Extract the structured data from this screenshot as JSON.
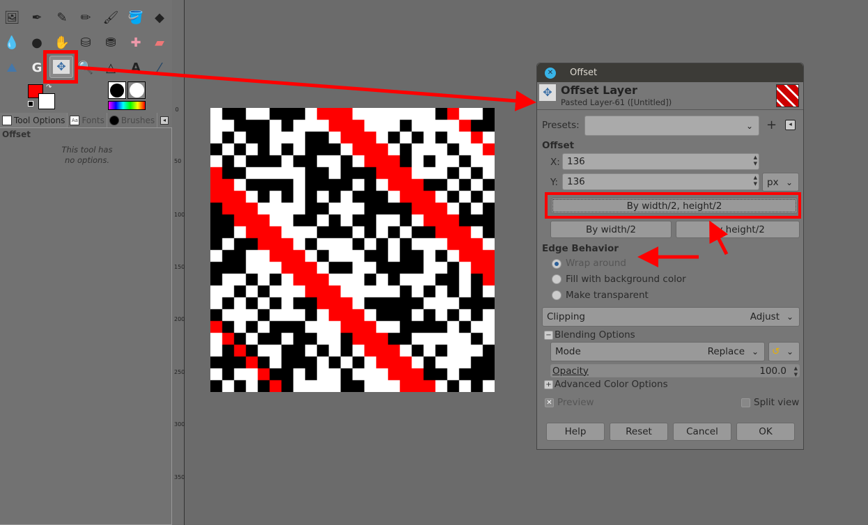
{
  "toolbox": {
    "tool_options_tab": "Tool Options",
    "fonts_tab": "Fonts",
    "brushes_tab": "Brushes",
    "options_title": "Offset",
    "options_message_line1": "This tool has",
    "options_message_line2": "no options.",
    "foreground_color": "#ff0000",
    "background_color": "#ffffff"
  },
  "ruler": {
    "labels": [
      "0",
      "50",
      "100",
      "150",
      "200",
      "250",
      "300",
      "350"
    ]
  },
  "dialog": {
    "window_title": "Offset",
    "header_title": "Offset Layer",
    "header_subtitle": "Pasted Layer-61 ([Untitled])",
    "presets_label": "Presets:",
    "presets_value": "",
    "offset_section": "Offset",
    "x_label": "X:",
    "x_value": "136",
    "y_label": "Y:",
    "y_value": "136",
    "unit": "px",
    "btn_both": "By width/2, height/2",
    "btn_width": "By width/2",
    "btn_height": "By height/2",
    "edge_section": "Edge Behavior",
    "edge_options": [
      {
        "label": "Wrap around",
        "selected": true
      },
      {
        "label": "Fill with background color",
        "selected": false
      },
      {
        "label": "Make transparent",
        "selected": false
      }
    ],
    "clipping_label": "Clipping",
    "clipping_value": "Adjust",
    "blending_label": "Blending Options",
    "mode_label": "Mode",
    "mode_value": "Replace",
    "opacity_label": "Opacity",
    "opacity_value": "100.0",
    "advanced_label": "Advanced Color Options",
    "preview_label": "Preview",
    "preview_checked": true,
    "split_label": "Split view",
    "split_checked": false,
    "help": "Help",
    "reset": "Reset",
    "cancel": "Cancel",
    "ok": "OK"
  },
  "annotation_color": "#ff0000"
}
